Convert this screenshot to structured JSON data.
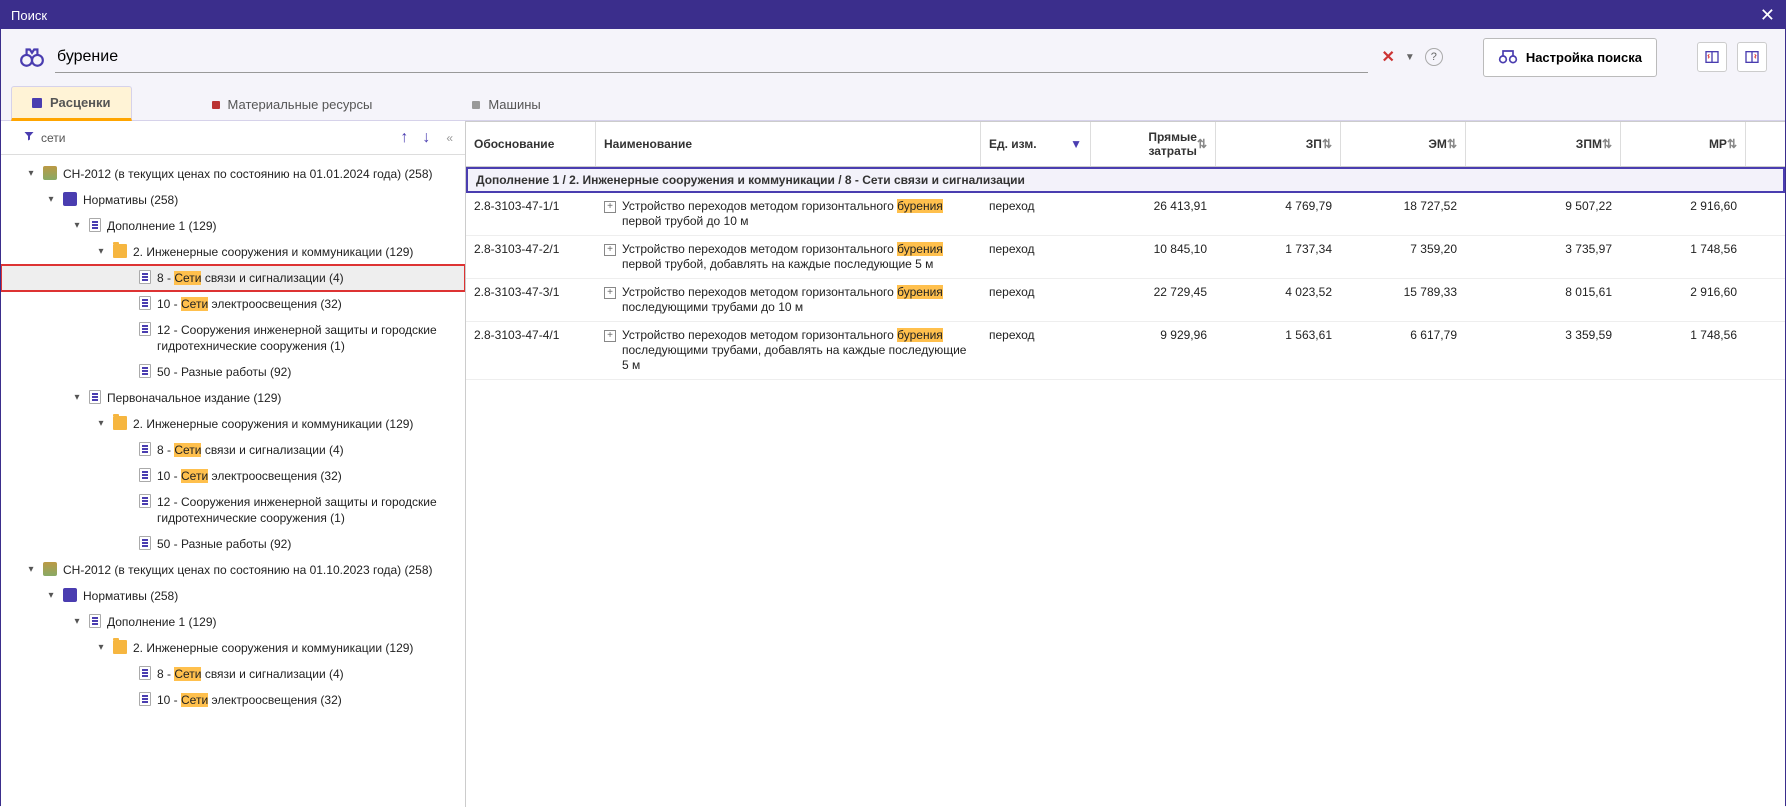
{
  "window": {
    "title": "Поиск"
  },
  "search": {
    "value": "бурение",
    "settings_label": "Настройка поиска"
  },
  "tabs": {
    "t0": "Расценки",
    "t1": "Материальные ресурсы",
    "t2": "Машины"
  },
  "filter": {
    "label": "сети"
  },
  "tree": {
    "n0": "СН-2012 (в текущих ценах по состоянию на 01.01.2024 года) (258)",
    "n0_0": "Нормативы (258)",
    "n0_0_0": "Дополнение 1 (129)",
    "n0_0_0_0": "2. Инженерные сооружения и коммуникации (129)",
    "n0_0_0_0_0_pre": "8 - ",
    "n0_0_0_0_0_hl": "Сети",
    "n0_0_0_0_0_suf": " связи и сигнализации (4)",
    "n0_0_0_0_1_pre": "10 - ",
    "n0_0_0_0_1_hl": "Сети",
    "n0_0_0_0_1_suf": " электроосвещения (32)",
    "n0_0_0_0_2": "12 - Сооружения инженерной защиты и городские гидротехнические сооружения (1)",
    "n0_0_0_0_3": "50 - Разные работы (92)",
    "n0_0_1": "Первоначальное издание (129)",
    "n0_0_1_0": "2. Инженерные сооружения и коммуникации (129)",
    "n0_0_1_0_0_pre": "8 - ",
    "n0_0_1_0_0_hl": "Сети",
    "n0_0_1_0_0_suf": " связи и сигнализации (4)",
    "n0_0_1_0_1_pre": "10 - ",
    "n0_0_1_0_1_hl": "Сети",
    "n0_0_1_0_1_suf": " электроосвещения (32)",
    "n0_0_1_0_2": "12 - Сооружения инженерной защиты и городские гидротехнические сооружения (1)",
    "n0_0_1_0_3": "50 - Разные работы (92)",
    "n1": "СН-2012 (в текущих ценах по состоянию на 01.10.2023 года) (258)",
    "n1_0": "Нормативы (258)",
    "n1_0_0": "Дополнение 1 (129)",
    "n1_0_0_0": "2. Инженерные сооружения и коммуникации (129)",
    "n1_0_0_0_0_pre": "8 - ",
    "n1_0_0_0_0_hl": "Сети",
    "n1_0_0_0_0_suf": " связи и сигнализации (4)",
    "n1_0_0_0_1_pre": "10 - ",
    "n1_0_0_0_1_hl": "Сети",
    "n1_0_0_0_1_suf": " электроосвещения (32)"
  },
  "grid": {
    "headers": {
      "obosn": "Обоснование",
      "naim": "Наименование",
      "unit": "Ед. изм.",
      "pz": "Прямые затраты",
      "zp": "ЗП",
      "em": "ЭМ",
      "zpm": "ЗПМ",
      "mr": "МР"
    },
    "breadcrumb": "Дополнение 1 / 2. Инженерные сооружения и коммуникации / 8 - Сети связи и сигнализации",
    "rows": [
      {
        "code": "2.8-3103-47-1/1",
        "name_pre": "Устройство переходов методом горизонтального ",
        "name_hl": "бурения",
        "name_suf": " первой трубой до 10 м",
        "unit": "переход",
        "pz": "26 413,91",
        "zp": "4 769,79",
        "em": "18 727,52",
        "zpm": "9 507,22",
        "mr": "2 916,60"
      },
      {
        "code": "2.8-3103-47-2/1",
        "name_pre": "Устройство переходов методом горизонтального ",
        "name_hl": "бурения",
        "name_suf": " первой трубой, добавлять на каждые последующие 5 м",
        "unit": "переход",
        "pz": "10 845,10",
        "zp": "1 737,34",
        "em": "7 359,20",
        "zpm": "3 735,97",
        "mr": "1 748,56"
      },
      {
        "code": "2.8-3103-47-3/1",
        "name_pre": "Устройство переходов методом горизонтального ",
        "name_hl": "бурения",
        "name_suf": " последующими трубами до 10 м",
        "unit": "переход",
        "pz": "22 729,45",
        "zp": "4 023,52",
        "em": "15 789,33",
        "zpm": "8 015,61",
        "mr": "2 916,60"
      },
      {
        "code": "2.8-3103-47-4/1",
        "name_pre": "Устройство переходов методом горизонтального ",
        "name_hl": "бурения",
        "name_suf": " последующими трубами, добавлять на каждые последующие 5 м",
        "unit": "переход",
        "pz": "9 929,96",
        "zp": "1 563,61",
        "em": "6 617,79",
        "zpm": "3 359,59",
        "mr": "1 748,56"
      }
    ]
  }
}
